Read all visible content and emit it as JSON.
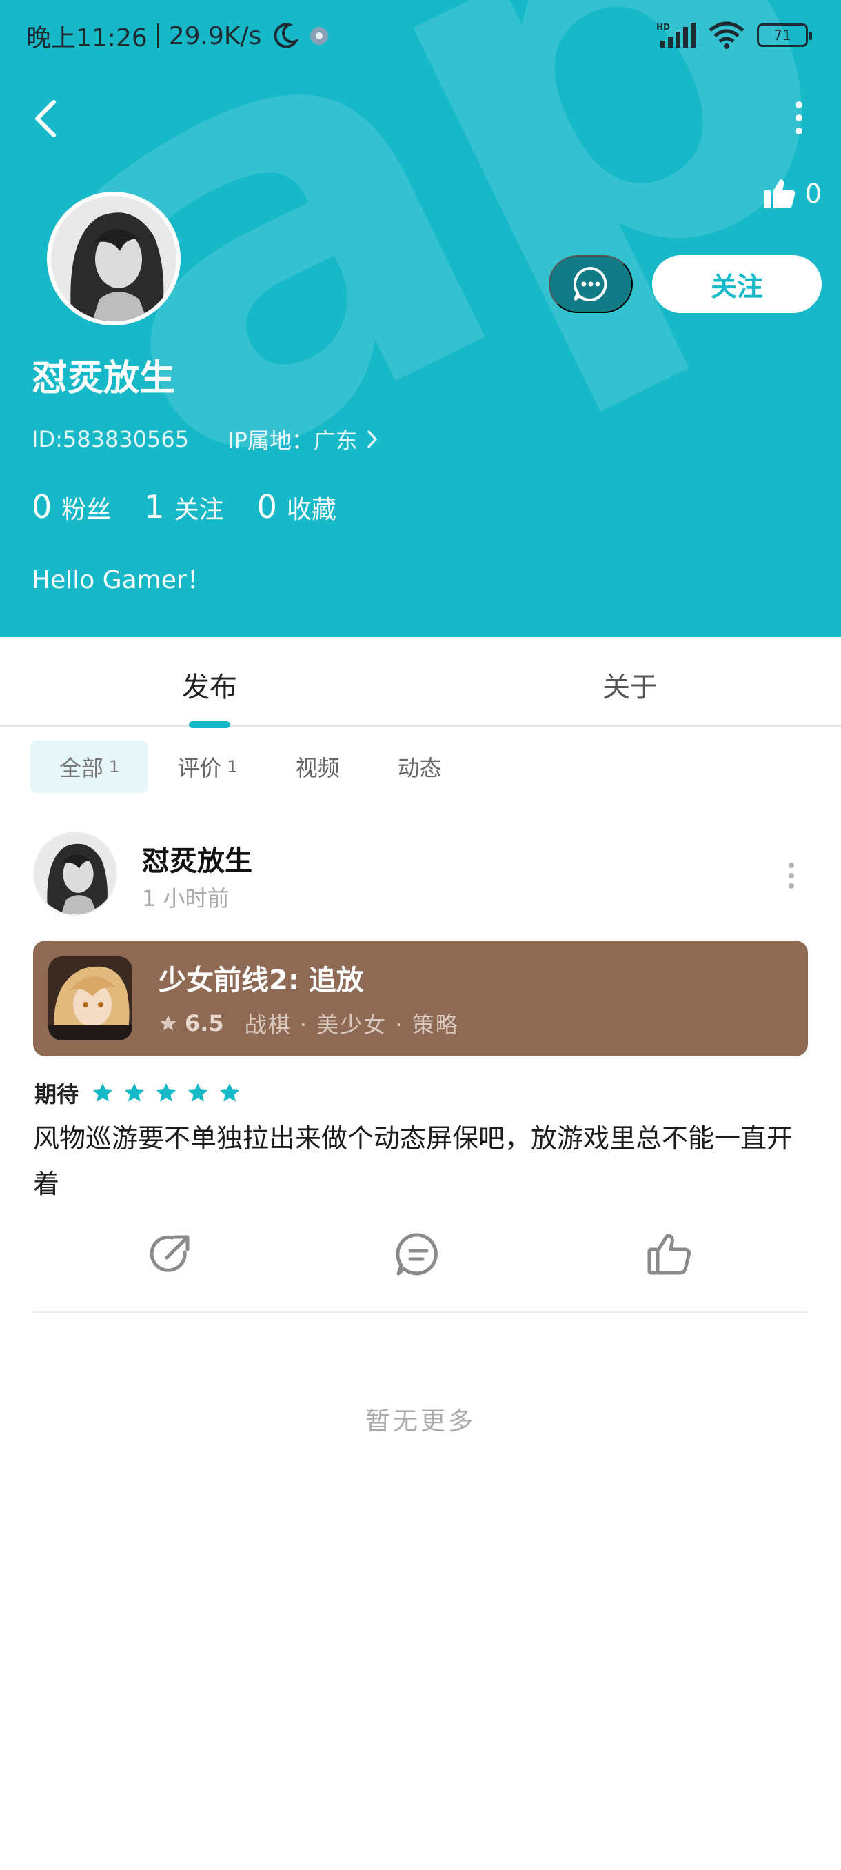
{
  "status_bar": {
    "time": "晚上11:26",
    "speed": "29.9K/s",
    "battery": "71"
  },
  "profile": {
    "likes": "0",
    "name": "怼烎放生",
    "follow_label": "关注",
    "id_text": "ID:583830565",
    "ip_text": "IP属地：广东",
    "stats": [
      {
        "num": "0",
        "label": "粉丝"
      },
      {
        "num": "1",
        "label": "关注"
      },
      {
        "num": "0",
        "label": "收藏"
      }
    ],
    "bio": "Hello Gamer！"
  },
  "tabs": [
    {
      "label": "发布",
      "active": true
    },
    {
      "label": "关于",
      "active": false
    }
  ],
  "subtabs": [
    {
      "label": "全部",
      "count": "1"
    },
    {
      "label": "评价",
      "count": "1"
    },
    {
      "label": "视频",
      "count": ""
    },
    {
      "label": "动态",
      "count": ""
    }
  ],
  "post": {
    "author": "怼烎放生",
    "time": "1 小时前",
    "game": {
      "title": "少女前线2: 追放",
      "score": "6.5",
      "tags": "战棋 · 美少女 · 策略"
    },
    "rating_label": "期待",
    "rating_stars": 5,
    "text": "风物巡游要不单独拉出来做个动态屏保吧，放游戏里总不能一直开着"
  },
  "footer": {
    "no_more": "暂无更多"
  },
  "colors": {
    "accent": "#17b9c9",
    "game_card": "#8e6a54"
  }
}
